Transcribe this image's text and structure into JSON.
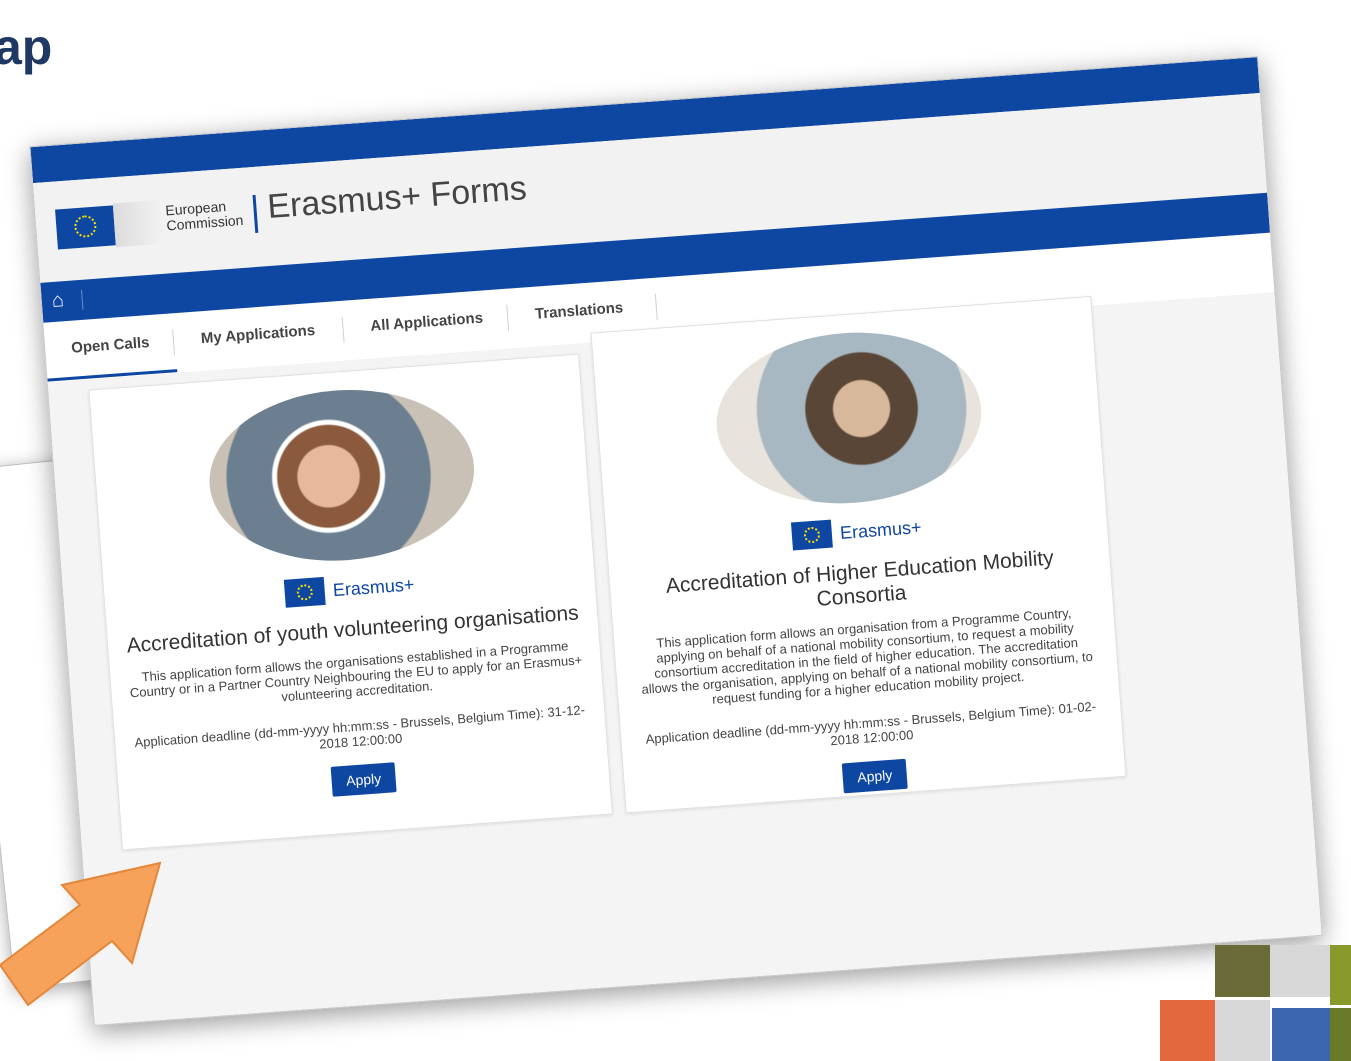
{
  "slide": {
    "title_fragment": "ap"
  },
  "header": {
    "org_line1": "European",
    "org_line2": "Commission",
    "app_title": "Erasmus+ Forms"
  },
  "nav": {
    "home_icon": "home-icon"
  },
  "tabs": [
    {
      "label": "Open Calls",
      "active": true
    },
    {
      "label": "My Applications",
      "active": false
    },
    {
      "label": "All Applications",
      "active": false
    },
    {
      "label": "Translations",
      "active": false
    }
  ],
  "cards": [
    {
      "brand": "Erasmus+",
      "title": "Accreditation of youth volunteering organisations",
      "description": "This application form allows the organisations established in a Programme Country or in a Partner Country Neighbouring the EU to apply for an Erasmus+ volunteering accreditation.",
      "deadline": "Application deadline (dd-mm-yyyy hh:mm:ss - Brussels, Belgium Time): 31-12-2018 12:00:00",
      "button": "Apply"
    },
    {
      "brand": "Erasmus+",
      "title": "Accreditation of Higher Education Mobility Consortia",
      "description": "This application form allows an organisation from a Programme Country, applying on behalf of a national mobility consortium, to request a mobility consortium accreditation in the field of higher education. The accreditation allows the organisation, applying on behalf of a national mobility consortium, to request funding for a higher education mobility project.",
      "deadline": "Application deadline (dd-mm-yyyy hh:mm:ss - Brussels, Belgium Time): 01-02-2018 12:00:00",
      "button": "Apply"
    }
  ],
  "colors": {
    "eu_blue": "#0e47a1",
    "title_navy": "#1f3864",
    "arrow_orange": "#f39a4e"
  }
}
